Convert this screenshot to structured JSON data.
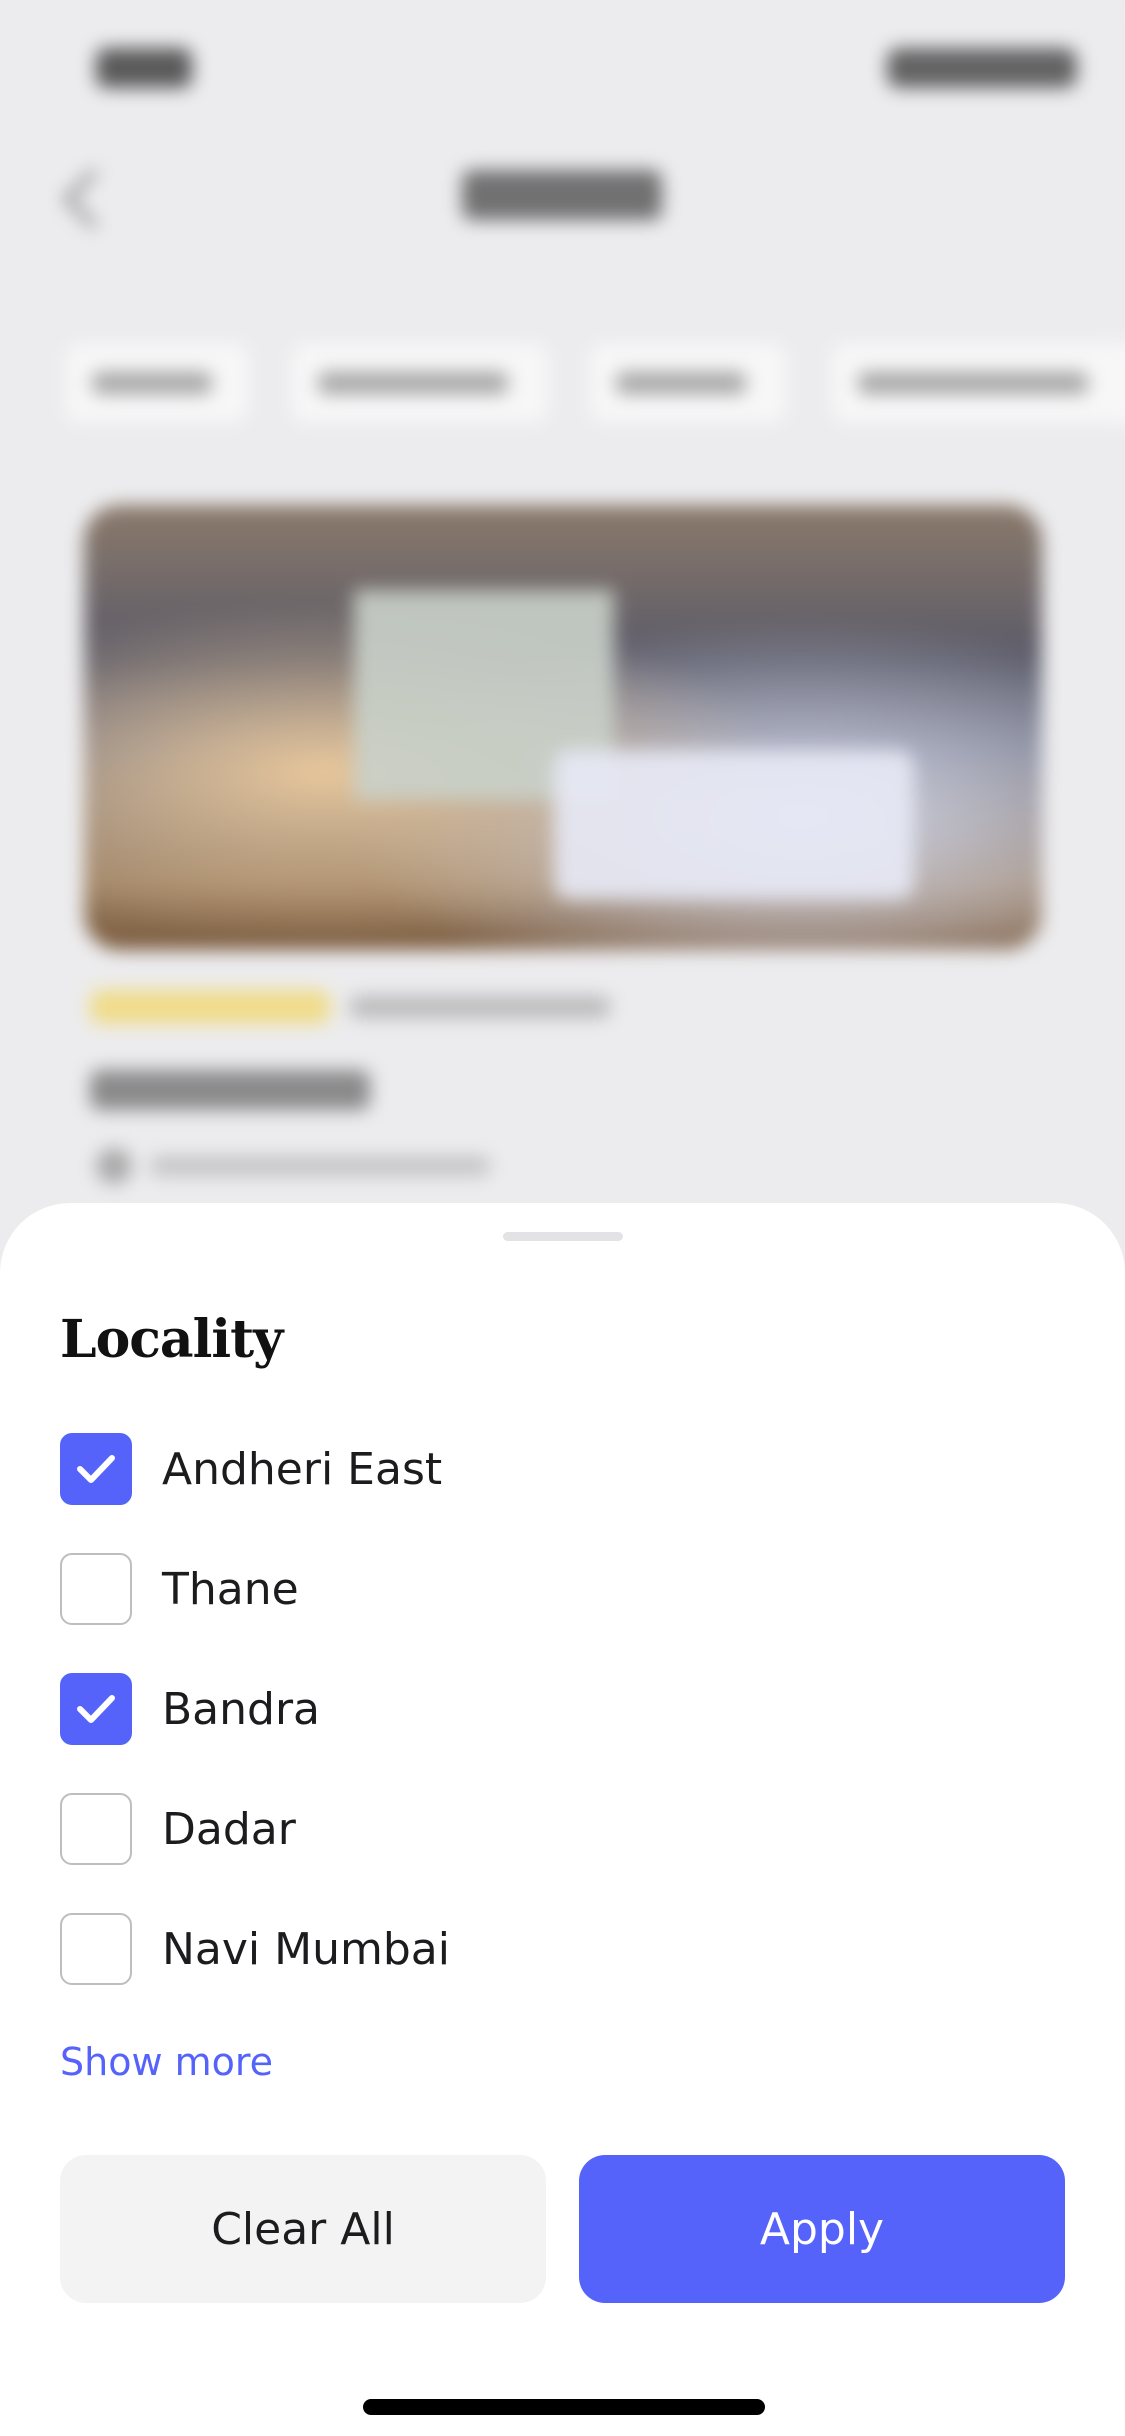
{
  "sheet": {
    "title": "Locality",
    "options": [
      {
        "label": "Andheri East",
        "checked": true
      },
      {
        "label": "Thane",
        "checked": false
      },
      {
        "label": "Bandra",
        "checked": true
      },
      {
        "label": "Dadar",
        "checked": false
      },
      {
        "label": "Navi Mumbai",
        "checked": false
      }
    ],
    "show_more_label": "Show more",
    "clear_label": "Clear All",
    "apply_label": "Apply"
  },
  "colors": {
    "accent": "#5563fa",
    "unchecked_border": "#bdbdc2",
    "clear_button_bg": "#f3f3f4"
  },
  "icons": {
    "back": "back-arrow-icon",
    "check": "checkmark-icon"
  }
}
